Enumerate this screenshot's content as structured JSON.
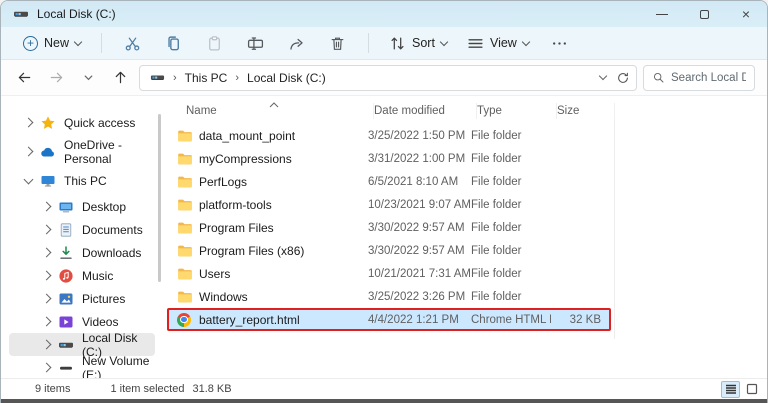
{
  "window": {
    "title": "Local Disk (C:)"
  },
  "commandbar": {
    "new_label": "New",
    "sort_label": "Sort",
    "view_label": "View"
  },
  "addressbar": {
    "breadcrumbs": [
      "This PC",
      "Local Disk (C:)"
    ],
    "search_placeholder": "Search Local Disk ..."
  },
  "sidebar": {
    "items": [
      {
        "label": "Quick access",
        "icon": "star",
        "level": 0,
        "expanded": false,
        "selected": false
      },
      {
        "label": "OneDrive - Personal",
        "icon": "cloud",
        "level": 0,
        "expanded": false,
        "selected": false
      },
      {
        "label": "This PC",
        "icon": "monitor",
        "level": 0,
        "expanded": true,
        "selected": false
      },
      {
        "label": "Desktop",
        "icon": "desktop",
        "level": 1,
        "expanded": false,
        "selected": false
      },
      {
        "label": "Documents",
        "icon": "document",
        "level": 1,
        "expanded": false,
        "selected": false
      },
      {
        "label": "Downloads",
        "icon": "download",
        "level": 1,
        "expanded": false,
        "selected": false
      },
      {
        "label": "Music",
        "icon": "music",
        "level": 1,
        "expanded": false,
        "selected": false
      },
      {
        "label": "Pictures",
        "icon": "pictures",
        "level": 1,
        "expanded": false,
        "selected": false
      },
      {
        "label": "Videos",
        "icon": "videos",
        "level": 1,
        "expanded": false,
        "selected": false
      },
      {
        "label": "Local Disk (C:)",
        "icon": "drive",
        "level": 1,
        "expanded": false,
        "selected": true
      },
      {
        "label": "New Volume (E:)",
        "icon": "drive2",
        "level": 1,
        "expanded": false,
        "selected": false
      }
    ]
  },
  "list": {
    "columns": [
      "Name",
      "Date modified",
      "Type",
      "Size"
    ],
    "rows": [
      {
        "name": "data_mount_point",
        "date": "3/25/2022 1:50 PM",
        "type": "File folder",
        "size": "",
        "icon": "folder",
        "selected": false
      },
      {
        "name": "myCompressions",
        "date": "3/31/2022 1:00 PM",
        "type": "File folder",
        "size": "",
        "icon": "folder",
        "selected": false
      },
      {
        "name": "PerfLogs",
        "date": "6/5/2021 8:10 AM",
        "type": "File folder",
        "size": "",
        "icon": "folder",
        "selected": false
      },
      {
        "name": "platform-tools",
        "date": "10/23/2021 9:07 AM",
        "type": "File folder",
        "size": "",
        "icon": "folder",
        "selected": false
      },
      {
        "name": "Program Files",
        "date": "3/30/2022 9:57 AM",
        "type": "File folder",
        "size": "",
        "icon": "folder",
        "selected": false
      },
      {
        "name": "Program Files (x86)",
        "date": "3/30/2022 9:57 AM",
        "type": "File folder",
        "size": "",
        "icon": "folder",
        "selected": false
      },
      {
        "name": "Users",
        "date": "10/21/2021 7:31 AM",
        "type": "File folder",
        "size": "",
        "icon": "folder",
        "selected": false
      },
      {
        "name": "Windows",
        "date": "3/25/2022 3:26 PM",
        "type": "File folder",
        "size": "",
        "icon": "folder",
        "selected": false
      },
      {
        "name": "battery_report.html",
        "date": "4/4/2022 1:21 PM",
        "type": "Chrome HTML Do...",
        "size": "32 KB",
        "icon": "chrome",
        "selected": true
      }
    ]
  },
  "statusbar": {
    "items_count": "9 items",
    "selection": "1 item selected",
    "selection_size": "31.8 KB"
  },
  "colors": {
    "selection_bg": "#cce8ff",
    "annotation_red": "#e0201f",
    "folder_yellow": "#ffd express96d",
    "titlebar_blue": "#d5ebf6"
  }
}
